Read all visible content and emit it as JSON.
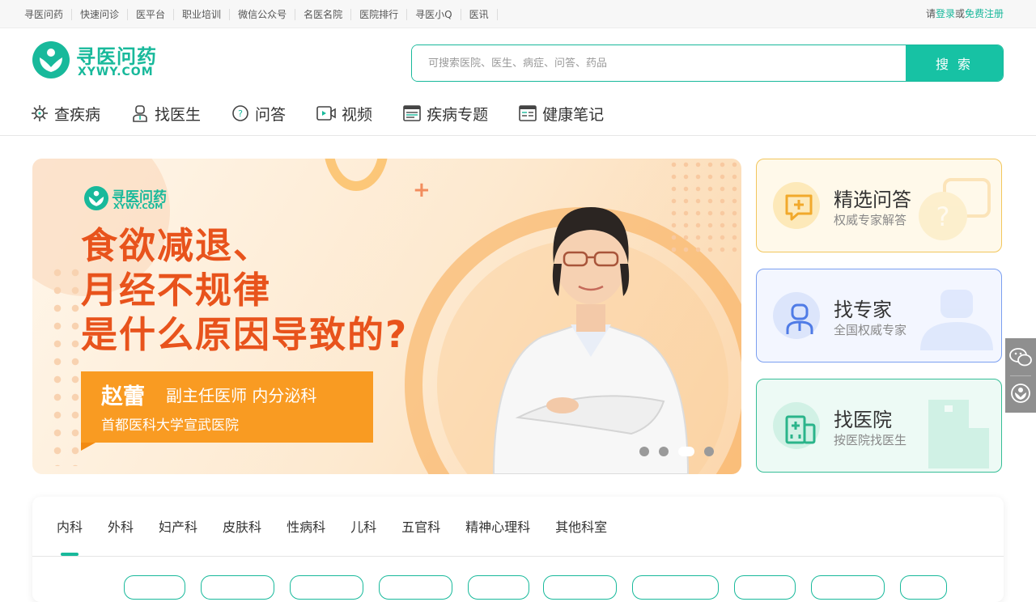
{
  "topbar": {
    "links": [
      "寻医问药",
      "快速问诊",
      "医平台",
      "职业培训",
      "微信公众号",
      "名医名院",
      "医院排行",
      "寻医小Q",
      "医讯"
    ],
    "login_prefix": "请",
    "login": "登录",
    "login_or": "或",
    "register": "免费注册"
  },
  "logo": {
    "cn": "寻医问药",
    "en": "XYWY.COM"
  },
  "search": {
    "placeholder": "可搜索医院、医生、病症、问答、药品",
    "button": "搜 索"
  },
  "nav": [
    {
      "label": "查疾病",
      "icon": "virus-icon"
    },
    {
      "label": "找医生",
      "icon": "doctor-icon"
    },
    {
      "label": "问答",
      "icon": "question-icon"
    },
    {
      "label": "视频",
      "icon": "video-icon"
    },
    {
      "label": "疾病专题",
      "icon": "topic-icon"
    },
    {
      "label": "健康笔记",
      "icon": "note-icon"
    }
  ],
  "banner": {
    "logo_cn": "寻医问药",
    "logo_en": "XYWY.COM",
    "headline": [
      "食欲减退、",
      "月经不规律",
      "是什么原因导致的?"
    ],
    "doctor_name": "赵蕾",
    "doctor_title": "副主任医师  内分泌科",
    "hospital": "首都医科大学宣武医院",
    "slides": 4,
    "active_slide": 3
  },
  "cards": [
    {
      "title": "精选问答",
      "sub": "权威专家解答",
      "icon": "chat-plus-icon",
      "color": "#f1a92b"
    },
    {
      "title": "找专家",
      "sub": "全国权威专家",
      "icon": "doctor-icon",
      "color": "#4f7be6"
    },
    {
      "title": "找医院",
      "sub": "按医院找医生",
      "icon": "hospital-icon",
      "color": "#2ab48a"
    }
  ],
  "departments": {
    "tabs": [
      "内科",
      "外科",
      "妇产科",
      "皮肤科",
      "性病科",
      "儿科",
      "五官科",
      "精神心理科",
      "其他科室"
    ],
    "active": 0
  },
  "colors": {
    "brand": "#18b99b",
    "accent_orange": "#e8531c"
  }
}
